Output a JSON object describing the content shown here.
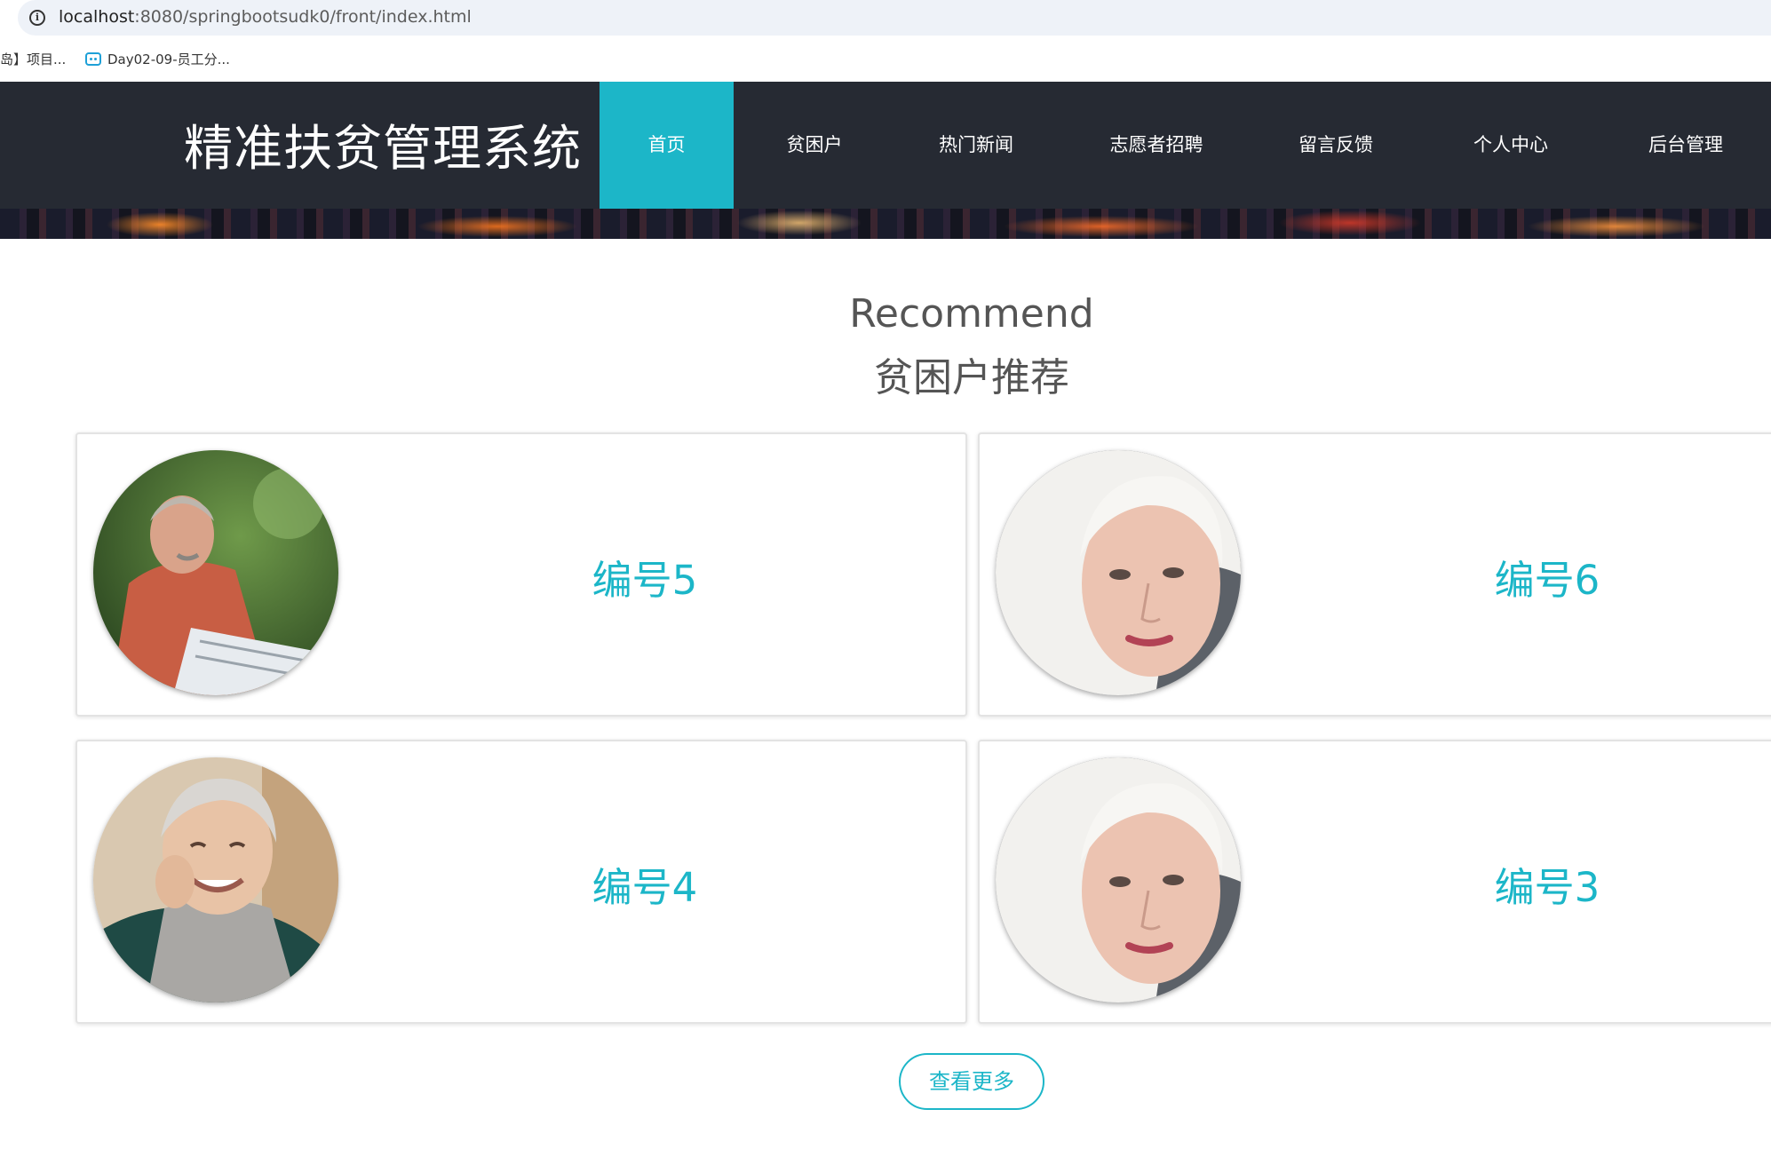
{
  "browser": {
    "url_host": "localhost",
    "url_rest": ":8080/springbootsudk0/front/index.html",
    "bookmarks": [
      "岛】项目...",
      "Day02-09-员工分..."
    ]
  },
  "site": {
    "title": "精准扶贫管理系统",
    "nav": [
      "首页",
      "贫困户",
      "热门新闻",
      "志愿者招聘",
      "留言反馈",
      "个人中心",
      "后台管理"
    ],
    "active_nav": "首页"
  },
  "section": {
    "title_en": "Recommend",
    "title_zh": "贫困户推荐"
  },
  "cards": [
    {
      "label": "编号5",
      "avatar": "elderly-man-reading-newspaper"
    },
    {
      "label": "编号6",
      "avatar": "elderly-woman-portrait"
    },
    {
      "label": "编号4",
      "avatar": "elderly-woman-smiling"
    },
    {
      "label": "编号3",
      "avatar": "elderly-woman-portrait"
    }
  ],
  "more_button": "查看更多",
  "colors": {
    "accent": "#1cb6c8",
    "header_bg": "#262a33"
  }
}
